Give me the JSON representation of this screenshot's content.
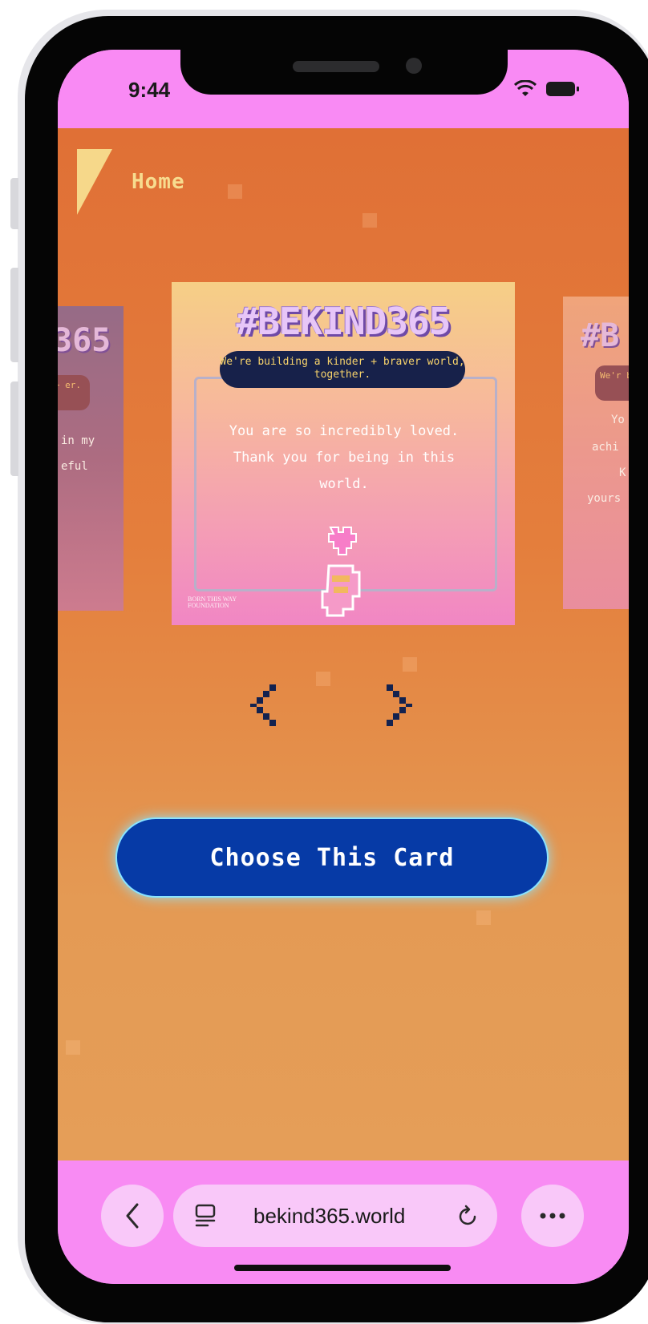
{
  "status_bar": {
    "time": "9:44"
  },
  "header": {
    "home_label": "Home"
  },
  "card": {
    "hashtag": "#BEKIND365",
    "tagline": "We're building a kinder + braver world, together.",
    "message": "You are so incredibly loved. Thank you for being in this world.",
    "logo_line1": "BORN THIS WAY",
    "logo_line2": "FOUNDATION"
  },
  "side_cards": {
    "left_hashtag": "365",
    "left_pill": "er + er.",
    "left_text_1": "in my",
    "left_text_2": "eful",
    "right_hashtag": "#B",
    "right_pill": "We'r bra",
    "right_text_1": "Yo",
    "right_text_2": "achi",
    "right_text_3": "K",
    "right_text_4": "yours"
  },
  "actions": {
    "choose_label": "Choose This Card"
  },
  "browser": {
    "url": "bekind365.world"
  },
  "colors": {
    "accent_button": "#063aa6",
    "browser_chrome": "#f88bf3",
    "home_text": "#f7dc8f"
  }
}
